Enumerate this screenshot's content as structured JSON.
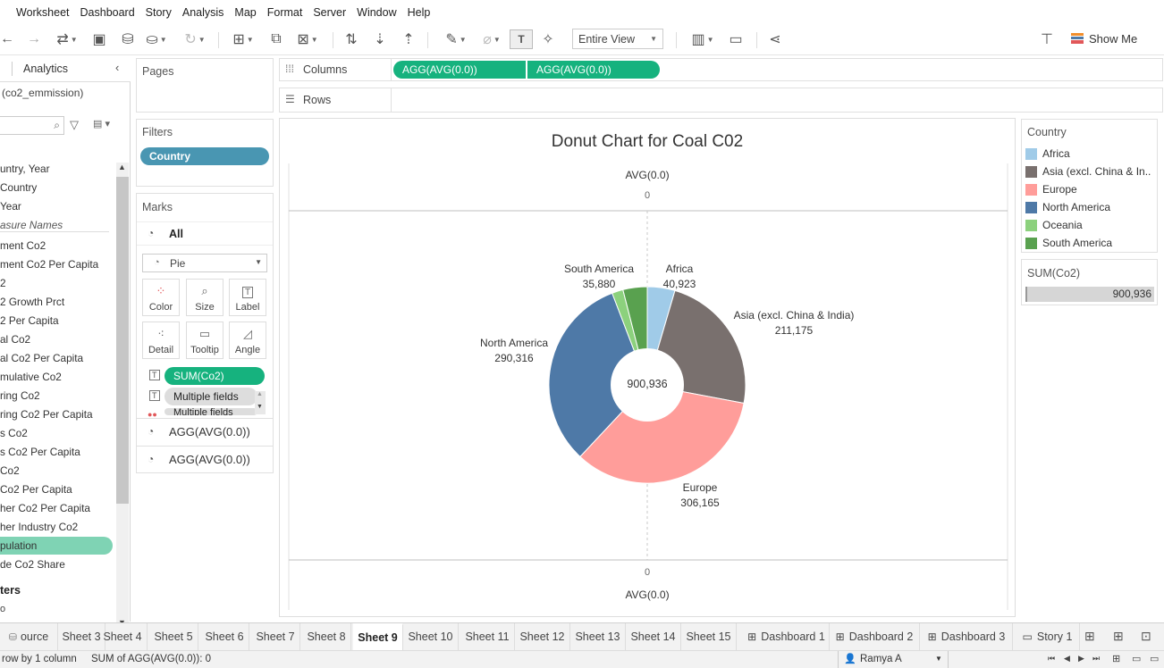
{
  "menu": [
    "Worksheet",
    "Dashboard",
    "Story",
    "Analysis",
    "Map",
    "Format",
    "Server",
    "Window",
    "Help"
  ],
  "toolbar": {
    "fit_label": "Entire View",
    "show_me_label": "Show Me"
  },
  "left_panel": {
    "tab_label": "Analytics",
    "datasource": "(co2_emmission)",
    "fields": [
      "untry, Year",
      "Country",
      "Year",
      "asure Names",
      "ment Co2",
      "ment Co2 Per Capita",
      "2",
      "2 Growth Prct",
      "2 Per Capita",
      "al Co2",
      "al Co2 Per Capita",
      "mulative Co2",
      "ring Co2",
      "ring Co2 Per Capita",
      "s Co2",
      "s Co2 Per Capita",
      "Co2",
      "Co2 Per Capita",
      "her Co2 Per Capita",
      "her Industry Co2",
      "pulation",
      "de Co2 Share"
    ],
    "parameters_label": "ters",
    "bottom_stub": "o"
  },
  "pages": {
    "title": "Pages"
  },
  "filters": {
    "title": "Filters",
    "pill": "Country"
  },
  "marks": {
    "title": "Marks",
    "all_label": "All",
    "mark_type": "Pie",
    "buttons": [
      "Color",
      "Size",
      "Label",
      "Detail",
      "Tooltip",
      "Angle"
    ],
    "pills": [
      "SUM(Co2)",
      "Multiple fields",
      "Multiple fields"
    ],
    "layers": [
      "AGG(AVG(0.0))",
      "AGG(AVG(0.0))"
    ]
  },
  "shelves": {
    "columns_label": "Columns",
    "rows_label": "Rows",
    "column_pills": [
      "AGG(AVG(0.0))",
      "AGG(AVG(0.0))"
    ]
  },
  "chart_data": {
    "type": "pie",
    "title": "Donut Chart for Coal C02",
    "axis_top_title": "AVG(0.0)",
    "axis_top_tick": "0",
    "axis_bottom_tick": "0",
    "axis_bottom_title": "AVG(0.0)",
    "center_label": "900,936",
    "total": 900936,
    "slices": [
      {
        "name": "Africa",
        "value": 40923,
        "label": "40,923",
        "color": "#a0cbe8"
      },
      {
        "name": "Asia (excl. China & India)",
        "value": 211175,
        "label": "211,175",
        "color": "#79706e"
      },
      {
        "name": "Europe",
        "value": 306165,
        "label": "306,165",
        "color": "#ff9d9a"
      },
      {
        "name": "North America",
        "value": 290316,
        "label": "290,316",
        "color": "#4e79a7"
      },
      {
        "name": "Oceania",
        "value": 16477,
        "label": "",
        "color": "#8cd17d"
      },
      {
        "name": "South America",
        "value": 35880,
        "label": "35,880",
        "color": "#59a14f"
      }
    ]
  },
  "legend": {
    "title": "Country",
    "items": [
      {
        "label": "Africa",
        "color": "#a0cbe8"
      },
      {
        "label": "Asia (excl. China & In..",
        "color": "#79706e"
      },
      {
        "label": "Europe",
        "color": "#ff9d9a"
      },
      {
        "label": "North America",
        "color": "#4e79a7"
      },
      {
        "label": "Oceania",
        "color": "#8cd17d"
      },
      {
        "label": "South America",
        "color": "#59a14f"
      }
    ],
    "size_title": "SUM(Co2)",
    "size_value": "900,936"
  },
  "tabs": [
    {
      "label": "ource",
      "kind": "ds"
    },
    {
      "label": "Sheet 3"
    },
    {
      "label": "Sheet 4"
    },
    {
      "label": "Sheet 5"
    },
    {
      "label": "Sheet 6"
    },
    {
      "label": "Sheet 7"
    },
    {
      "label": "Sheet 8"
    },
    {
      "label": "Sheet 9",
      "active": true
    },
    {
      "label": "Sheet 10"
    },
    {
      "label": "Sheet 11"
    },
    {
      "label": "Sheet 12"
    },
    {
      "label": "Sheet 13"
    },
    {
      "label": "Sheet 14"
    },
    {
      "label": "Sheet 15"
    },
    {
      "label": "Dashboard 1",
      "kind": "dash"
    },
    {
      "label": "Dashboard 2",
      "kind": "dash"
    },
    {
      "label": "Dashboard 3",
      "kind": "dash"
    },
    {
      "label": "Story 1",
      "kind": "story"
    }
  ],
  "status": {
    "rows_cols": "row by 1 column",
    "sum_text": "SUM of AGG(AVG(0.0)): 0",
    "user": "Ramya A"
  },
  "colors": {
    "green_pill": "#16b27e",
    "blue_pill": "#4996b2",
    "active_field": "#7fd3b4"
  }
}
